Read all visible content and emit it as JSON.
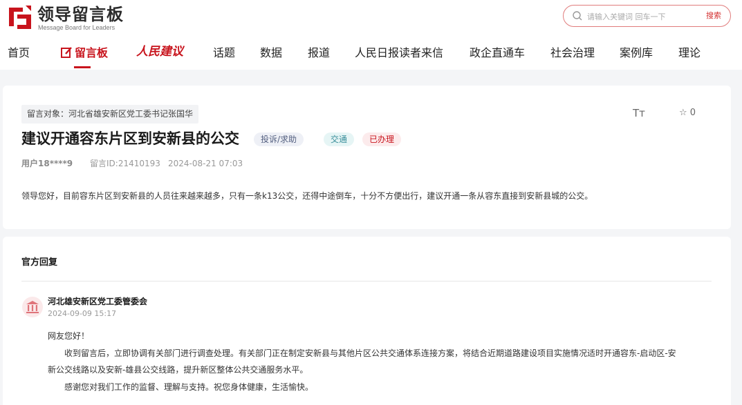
{
  "header": {
    "logo_cn": "领导留言板",
    "logo_en": "Message Board for Leaders",
    "search_placeholder": "请输入关键词 回车一下",
    "search_button": "搜索"
  },
  "nav": {
    "home": "首页",
    "board": "留言板",
    "people_suggest": "人民建议",
    "topics": "话题",
    "data": "数据",
    "reports": "报道",
    "readers": "人民日报读者来信",
    "enterprise": "政企直通车",
    "governance": "社会治理",
    "cases": "案例库",
    "theory": "理论"
  },
  "message": {
    "target": "留言对象：河北省雄安新区党工委书记张国华",
    "font_toggle": "Tт",
    "star_count": "☆ 0",
    "title": "建议开通容东片区到安新县的公交",
    "tags": {
      "type": "投诉/求助",
      "domain": "交通",
      "status": "已办理"
    },
    "user": "用户18****9",
    "message_id": "留言ID:21410193",
    "time": "2024-08-21 07:03",
    "content": "领导您好，目前容东片区到安新县的人员往来越来越多，只有一条k13公交，还得中途倒车，十分不方便出行，建议开通一条从容东直接到安新县城的公交。"
  },
  "reply": {
    "heading": "官方回复",
    "org": "河北雄安新区党工委管委会",
    "time": "2024-09-09 15:17",
    "greeting": "网友您好！",
    "para1_line1": "收到留言后，立即协调有关部门进行调查处理。有关部门正在制定安新县与其他片区公共交通体系连接方案，将结合近期道路建设项目实施情况适时开通容东-启动区-安",
    "para1_line2": "新公交线路以及安新-雄县公交线路，提升新区整体公共交通服务水平。",
    "para2": "感谢您对我们工作的监督、理解与支持。祝您身体健康，生活愉快。"
  },
  "colors": {
    "brand_red": "#c8141d",
    "page_bg": "#f4f5f7"
  }
}
